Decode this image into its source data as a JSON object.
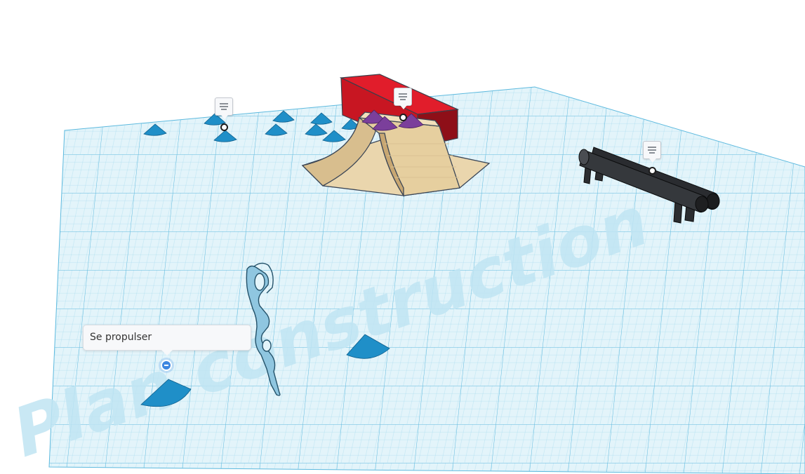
{
  "workplane": {
    "watermark_text": "Plan construction",
    "grid_color": "#6ec6e4",
    "grid_fill": "#dff1f8"
  },
  "objects": [
    {
      "name": "quarter-pipe-ramp",
      "color": "#e8d3a6"
    },
    {
      "name": "red-box",
      "color": "#d81f2c"
    },
    {
      "name": "grind-rail",
      "color": "#1f2124"
    },
    {
      "name": "cones",
      "color": "#1f8fc8"
    },
    {
      "name": "purple-cones",
      "color": "#7b3f9b"
    },
    {
      "name": "chain-link-shape",
      "color": "#8fc6e0"
    }
  ],
  "note": {
    "text": "Se propulser"
  },
  "icons": {
    "note_pin": "note-icon",
    "minus_handle": "minus-icon"
  }
}
